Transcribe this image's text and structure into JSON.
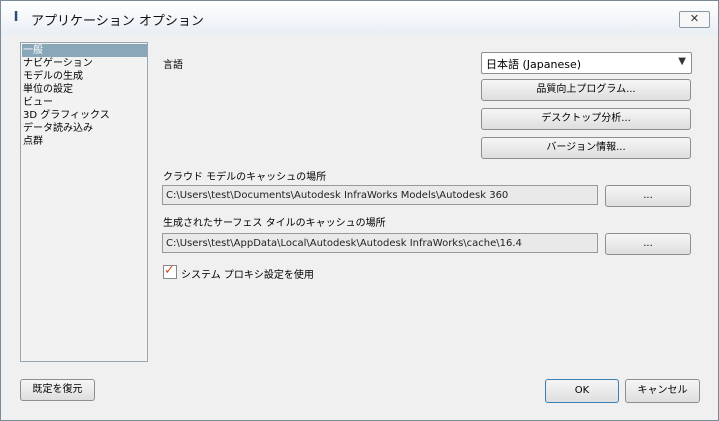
{
  "window": {
    "title": "アプリケーション オプション",
    "close_glyph": "✕"
  },
  "nav": {
    "items": [
      {
        "label": "一般",
        "selected": true
      },
      {
        "label": "ナビゲーション",
        "selected": false
      },
      {
        "label": "モデルの生成",
        "selected": false
      },
      {
        "label": "単位の設定",
        "selected": false
      },
      {
        "label": "ビュー",
        "selected": false
      },
      {
        "label": "3D グラフィックス",
        "selected": false
      },
      {
        "label": "データ読み込み",
        "selected": false
      },
      {
        "label": "点群",
        "selected": false
      }
    ]
  },
  "settings": {
    "language_label": "言語",
    "language_value": "日本語 (Japanese)",
    "quality_button": "品質向上プログラム...",
    "desktop_analytics_button": "デスクトップ分析...",
    "version_info_button": "バージョン情報...",
    "cloud_cache_label": "クラウド モデルのキャッシュの場所",
    "cloud_cache_path": "C:\\Users\\test\\Documents\\Autodesk InfraWorks Models\\Autodesk 360",
    "surface_cache_label": "生成されたサーフェス タイルのキャッシュの場所",
    "surface_cache_path": "C:\\Users\\test\\AppData\\Local\\Autodesk\\Autodesk InfraWorks\\cache\\16.4",
    "browse_label": "...",
    "proxy_label": "システム プロキシ設定を使用",
    "proxy_checked": true
  },
  "footer": {
    "restore_defaults": "既定を復元",
    "ok": "OK",
    "cancel": "キャンセル"
  }
}
